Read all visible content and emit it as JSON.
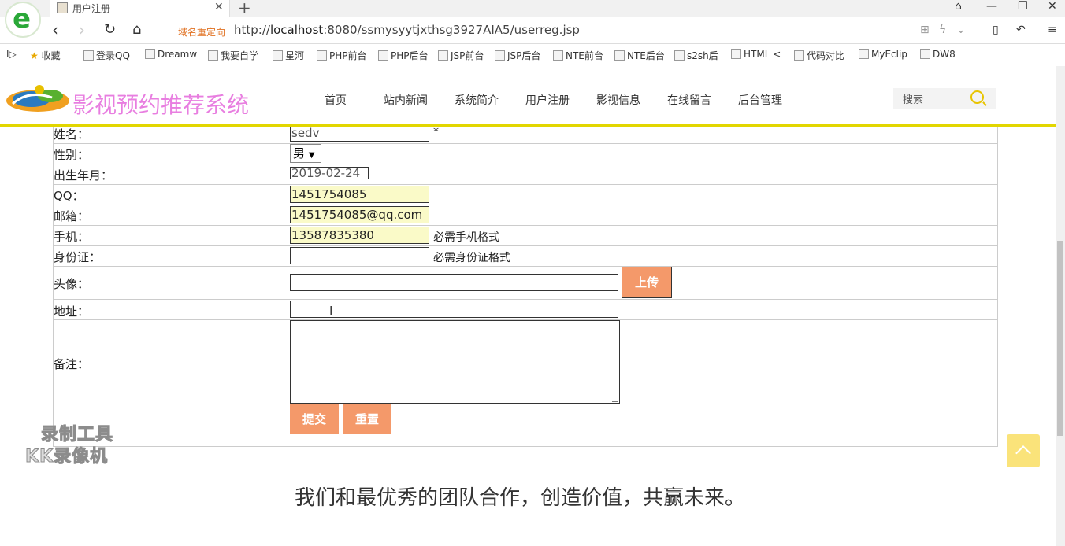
{
  "browser": {
    "tab_title": "用户注册",
    "redirect_tag": "域名重定向",
    "url_prefix": "http://",
    "url_host": "localhost",
    "url_rest": ":8080/ssmysyytjxthsg3927AIA5/userreg.jsp",
    "bookmarks": [
      "收藏",
      "登录QQ",
      "Dreamw",
      "我要自学",
      "星河",
      "PHP前台",
      "PHP后台",
      "JSP前台",
      "JSP后台",
      "NTE前台",
      "NTE后台",
      "s2sh后",
      "HTML <",
      "代码对比",
      "MyEclip",
      "DW8",
      "Ⅰ▷"
    ]
  },
  "site": {
    "title": "影视预约推荐系统",
    "nav": [
      "首页",
      "站内新闻",
      "系统简介",
      "用户注册",
      "影视信息",
      "在线留言",
      "后台管理"
    ],
    "search_placeholder": "搜索"
  },
  "form": {
    "rows": {
      "name": {
        "label": "姓名：",
        "value": "sedv",
        "required": "*"
      },
      "gender": {
        "label": "性别：",
        "value": "男"
      },
      "birth": {
        "label": "出生年月：",
        "value": "2019-02-24"
      },
      "qq": {
        "label": "QQ：",
        "value": "1451754085"
      },
      "email": {
        "label": "邮箱：",
        "value": "1451754085@qq.com"
      },
      "phone": {
        "label": "手机：",
        "value": "13587835380",
        "hint": "必需手机格式"
      },
      "idcard": {
        "label": "身份证：",
        "value": "",
        "hint": "必需身份证格式"
      },
      "avatar": {
        "label": "头像：",
        "value": "",
        "button": "上传"
      },
      "address": {
        "label": "地址：",
        "value": ""
      },
      "note": {
        "label": "备注：",
        "value": ""
      }
    },
    "submit": "提交",
    "reset": "重置"
  },
  "footer": {
    "slogan": "我们和最优秀的团队合作，创造价值，共赢未来。"
  },
  "watermark": {
    "line1": "录制工具",
    "line2": "KK录像机"
  }
}
